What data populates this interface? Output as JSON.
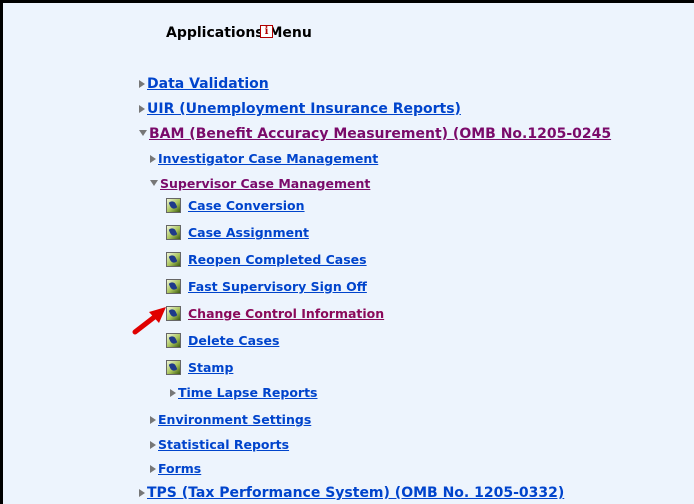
{
  "menu": {
    "title": "Applications Menu",
    "info_icon": "i",
    "items": {
      "data_validation": "Data Validation",
      "uir": "UIR (Unemployment Insurance Reports)",
      "bam": "BAM (Benefit Accuracy Measurement) (OMB No.1205-0245",
      "investigator": "Investigator Case Management",
      "supervisor": "Supervisor Case Management",
      "case_conversion": "Case Conversion",
      "case_assignment": "Case Assignment",
      "reopen": "Reopen Completed Cases",
      "fast_signoff": "Fast Supervisory Sign Off",
      "change_control": "Change Control Information",
      "delete_cases": "Delete Cases",
      "stamp": "Stamp",
      "time_lapse": "Time Lapse Reports",
      "environment": "Environment Settings",
      "statistical": "Statistical Reports",
      "forms": "Forms",
      "tps": "TPS (Tax Performance System) (OMB No. 1205-0332)"
    }
  },
  "colors": {
    "link": "#0044cc",
    "visited": "#7a0a6a",
    "background": "#edf4fd",
    "arrow": "#e00000"
  },
  "icons": {
    "expander": "triangle-right",
    "expanded": "triangle-down",
    "app": "application-icon",
    "pointer": "red-arrow"
  }
}
